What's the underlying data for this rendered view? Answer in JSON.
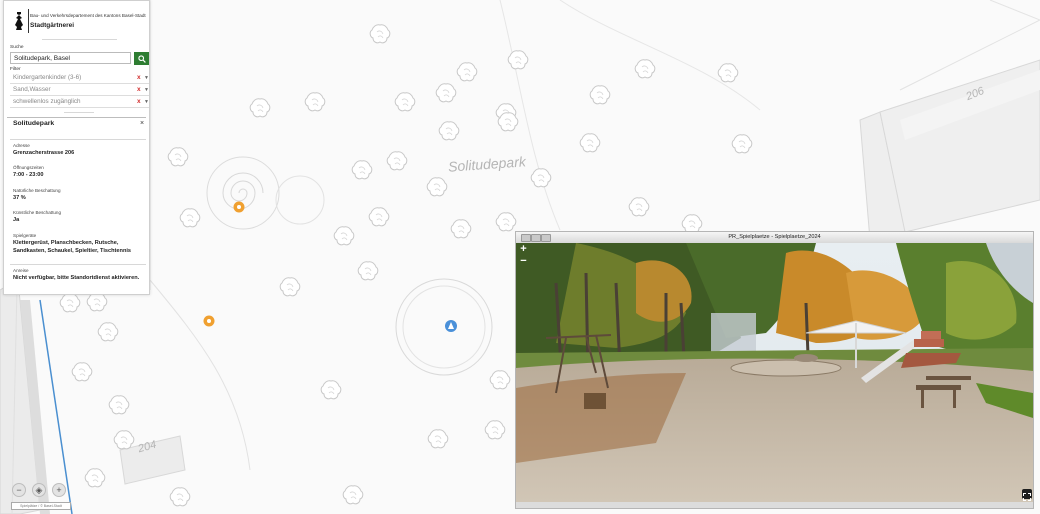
{
  "map": {
    "park_label": "Solitudepark",
    "house_numbers": [
      "206",
      "204"
    ],
    "scale_text": "Spielplätze / © Basel-Stadt"
  },
  "header": {
    "department": "Bau- und Verkehrsdepartement des Kantons Basel-Stadt",
    "name": "Stadtgärtnerei"
  },
  "search": {
    "label": "Suche",
    "value": "Solitudepark, Basel"
  },
  "filter": {
    "label": "Filter",
    "items": [
      {
        "text": "Kindergartenkinder (3-6)",
        "remove": "x"
      },
      {
        "text": "Sand,Wasser",
        "remove": "x"
      },
      {
        "text": "schwellenlos zugänglich",
        "remove": "x"
      }
    ]
  },
  "details": {
    "title": "Solitudepark",
    "close": "×",
    "fields": [
      {
        "label": "Adresse",
        "value": "Grenzacherstrasse 206"
      },
      {
        "label": "Öffnungszeiten",
        "value": "7:00 - 23:00"
      },
      {
        "label": "Natürliche Beschattung",
        "value": "37 %"
      },
      {
        "label": "Künstliche Beschattung",
        "value": "Ja"
      },
      {
        "label": "Spielgeräte",
        "value": "Klettergerüst, Planschbecken, Rutsche, Sandkasten, Schaukel, Spieltier, Tischtennis"
      },
      {
        "label": "Anreise",
        "value": "Nicht verfügbar, bitte Standortdienst aktivieren."
      }
    ]
  },
  "viewer": {
    "title": "PR_Spielplaetze - Spielplaetze_2024",
    "zoom_in": "+",
    "zoom_out": "−"
  },
  "colors": {
    "accent": "#2e7d32",
    "remove": "#d32f2f",
    "marker_orange": "#f0a030",
    "marker_blue": "#4a90d9"
  },
  "icons": [
    "search-icon",
    "zoom-in-icon",
    "zoom-out-icon",
    "locate-icon",
    "expand-icon",
    "close-icon",
    "chevron-down-icon",
    "tree-icon",
    "playground-marker-icon",
    "panorama-position-icon"
  ]
}
